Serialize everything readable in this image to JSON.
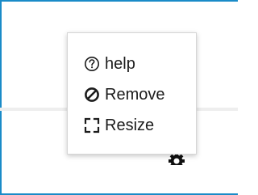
{
  "menu": {
    "items": [
      {
        "label": "help",
        "icon": "help-circle-icon"
      },
      {
        "label": "Remove",
        "icon": "remove-circle-icon"
      },
      {
        "label": "Resize",
        "icon": "resize-expand-icon"
      }
    ]
  },
  "background": {
    "gear_icon": "gear-icon"
  },
  "colors": {
    "frame_border": "#1a8bc8",
    "menu_border": "#d5d5d5",
    "text": "#1c1c1c",
    "divider": "#eeeeee"
  }
}
